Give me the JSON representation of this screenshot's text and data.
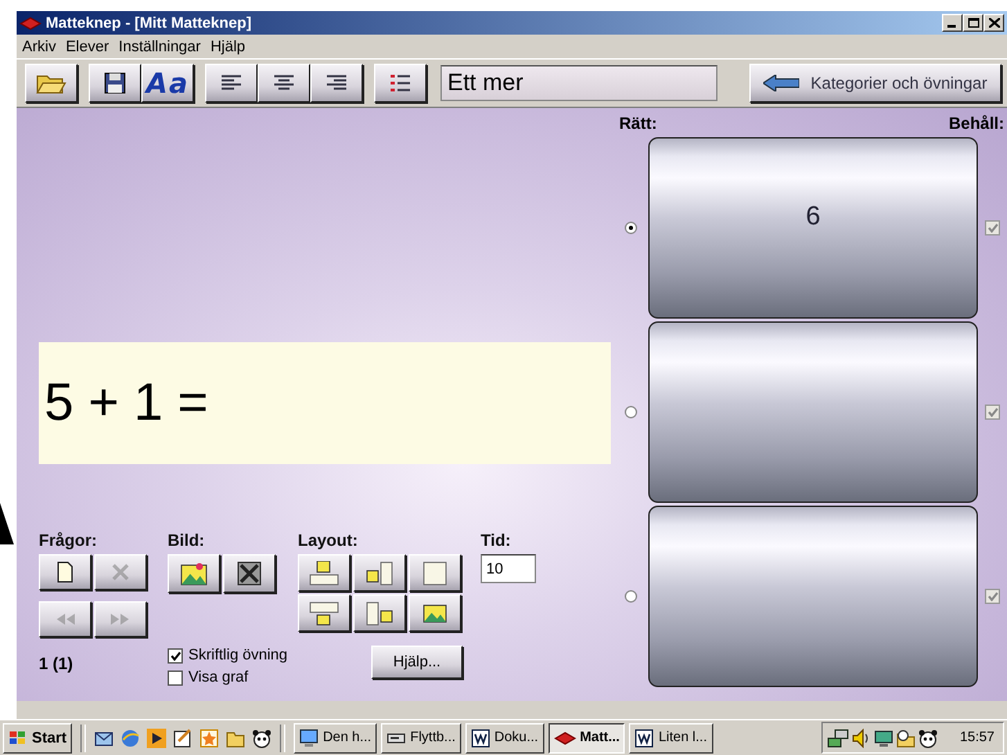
{
  "window": {
    "title": "Matteknep - [Mitt Matteknep]"
  },
  "menu": [
    {
      "label": "Arkiv"
    },
    {
      "label": "Elever"
    },
    {
      "label": "Inställningar"
    },
    {
      "label": "Hjälp"
    }
  ],
  "toolbar": {
    "buttons": [
      {
        "kind": "open"
      },
      {
        "kind": "save"
      },
      {
        "kind": "font",
        "label": "Aa"
      },
      {
        "kind": "align_left"
      },
      {
        "kind": "align_center"
      },
      {
        "kind": "align_right"
      },
      {
        "kind": "list"
      }
    ],
    "field": {
      "value": "Ett mer"
    },
    "nav_button": {
      "label": "Kategorier och övningar"
    }
  },
  "question": {
    "text": "5 + 1 ="
  },
  "answers": {
    "correct_label": {
      "label": "Rätt:"
    },
    "keep_label": {
      "label": "Behåll:"
    },
    "items": [
      {
        "text": "6",
        "selected": true,
        "keep": true
      },
      {
        "selected": false,
        "keep": true
      },
      {
        "selected": false,
        "keep": true
      }
    ]
  },
  "questions": {
    "label": "Frågor:",
    "buttons": [
      {
        "kind": "new",
        "disabled": false
      },
      {
        "kind": "delete",
        "disabled": true
      },
      {
        "kind": "previous",
        "disabled": true
      },
      {
        "kind": "next",
        "disabled": true
      }
    ],
    "counter": "1 (1)"
  },
  "picture": {
    "label": "Bild:",
    "buttons": [
      {
        "kind": "insert"
      },
      {
        "kind": "remove"
      }
    ]
  },
  "layout": {
    "label": "Layout:",
    "buttons": [
      {
        "kind": "picture_top"
      },
      {
        "kind": "picture_left"
      },
      {
        "kind": "text_only"
      },
      {
        "kind": "picture_bottom"
      },
      {
        "kind": "picture_right"
      },
      {
        "kind": "picture_only"
      }
    ]
  },
  "time": {
    "label": "Tid:",
    "value": "10"
  },
  "options": [
    {
      "label": "Skriftlig övning",
      "checked": true
    },
    {
      "label": "Visa graf",
      "checked": false
    }
  ],
  "help_button": {
    "label": "Hjälp..."
  },
  "taskbar": {
    "start": "Start",
    "quick_launch": [
      {
        "kind": "mail"
      },
      {
        "kind": "browser"
      },
      {
        "kind": "media"
      },
      {
        "kind": "notepad"
      },
      {
        "kind": "star"
      },
      {
        "kind": "folder"
      },
      {
        "kind": "panda"
      }
    ],
    "tasks": [
      {
        "label": "Den h...",
        "kind": "computer",
        "selected": false
      },
      {
        "label": "Flyttb...",
        "kind": "drive",
        "selected": false
      },
      {
        "label": "Doku...",
        "kind": "word",
        "selected": false
      },
      {
        "label": "Matt...",
        "kind": "app",
        "selected": true
      },
      {
        "label": "Liten l...",
        "kind": "word",
        "selected": false
      }
    ],
    "tray": [
      {
        "kind": "network"
      },
      {
        "kind": "volume"
      },
      {
        "kind": "display"
      },
      {
        "kind": "scheduler"
      },
      {
        "kind": "panda"
      }
    ],
    "clock": "15:57"
  }
}
